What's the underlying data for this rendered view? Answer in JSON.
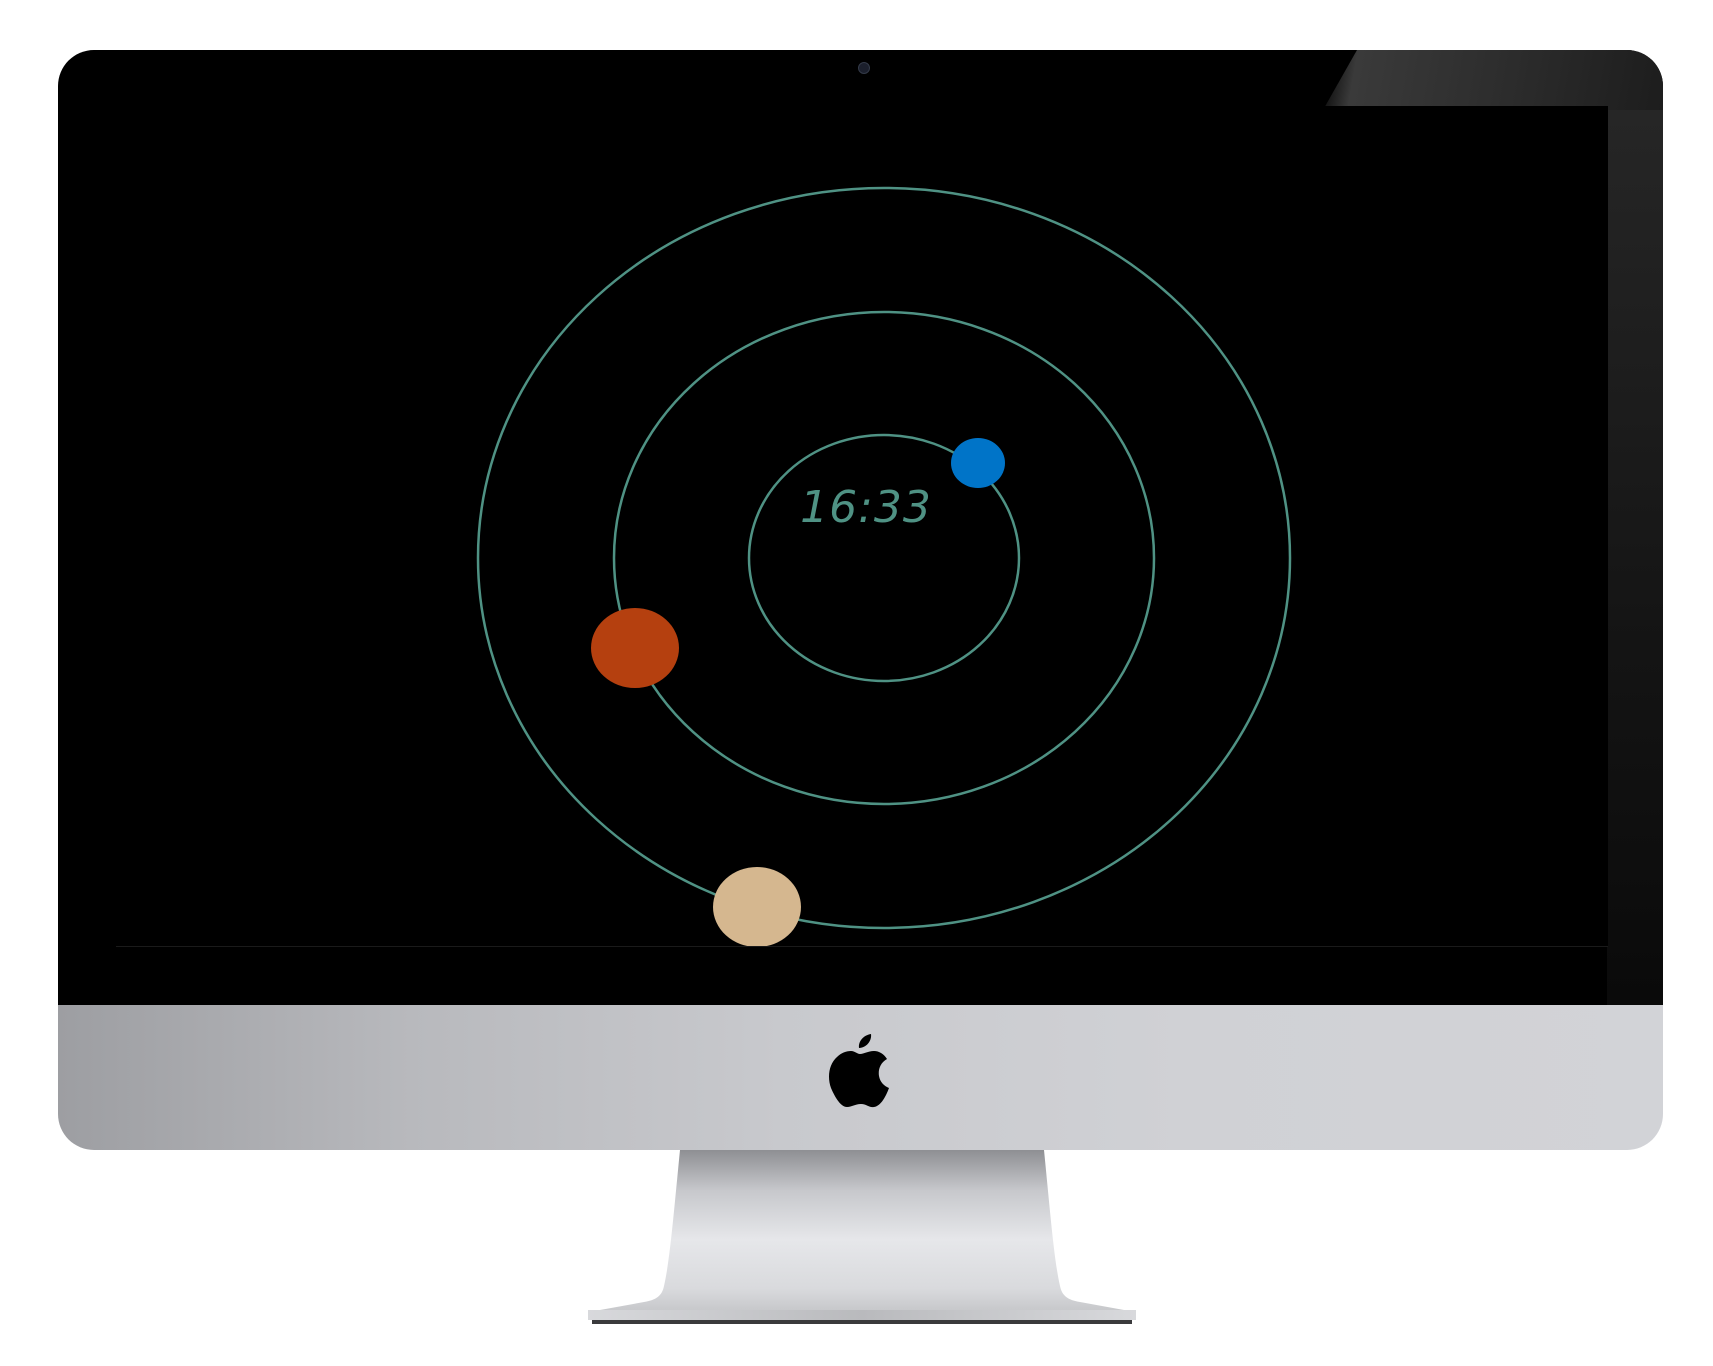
{
  "screen": {
    "clock_time": "16:33",
    "orbit_color": "#4f9284",
    "background_color": "#000000"
  },
  "planets": [
    {
      "name": "blue-planet",
      "color": "#0074c8"
    },
    {
      "name": "red-planet",
      "color": "#b5400f"
    },
    {
      "name": "tan-planet",
      "color": "#d5b78f"
    }
  ],
  "device": {
    "logo_icon": "apple-logo-icon",
    "bezel_color": "#000000",
    "chin_color": "#c8c9cd"
  }
}
